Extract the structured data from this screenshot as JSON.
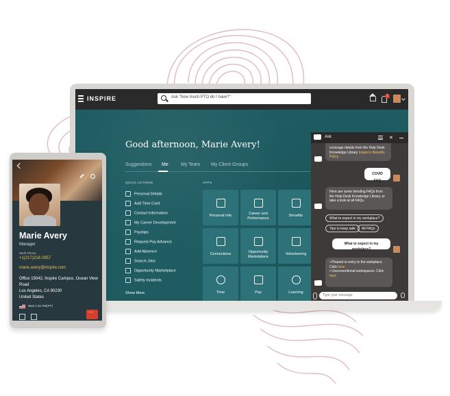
{
  "app": {
    "brand": "INSPIRE",
    "search_placeholder": "Ask \"how much PTO do I have?\"",
    "notification_count": "1"
  },
  "greeting": "Good afternoon, Marie Avery!",
  "tabs": [
    "Suggestions",
    "Me",
    "My Team",
    "My Client Groups"
  ],
  "active_tab": "Me",
  "quick_actions": {
    "heading": "QUICK ACTIONS",
    "items": [
      "Personal Details",
      "Add Time Card",
      "Contact Information",
      "My Career Development",
      "Payslips",
      "Request Pay Advance",
      "Add Absence",
      "Search Jobs",
      "Opportunity Marketplace",
      "Safety Incidents"
    ],
    "show_more": "Show More"
  },
  "apps": {
    "heading": "APPS",
    "tiles": [
      "Personal Info",
      "Career and Performance",
      "Benefits",
      "Connections",
      "Opportunity Marketplace",
      "Volunteering",
      "Time",
      "Pay",
      "Learning"
    ]
  },
  "chat": {
    "title": "Ask",
    "bot_msg_1": "coverage details from the Help Desk Knowledge Library",
    "bot_msg_1_link": "Inspire's Benefits Policy",
    "user_msg_1": "COVID FAQ",
    "bot_msg_2": "Here are some trending FAQs from the Help Desk Knowledge Library, or take a look at all FAQs.",
    "chips": [
      "What to expect in my workplace?",
      "Tips to keep safe",
      "All FAQs"
    ],
    "user_msg_2": "What to expect in my workplace?",
    "bullet_1": "Phased re-entry to the workplace. Click",
    "bullet_2": "Unconventional workspaces. Click",
    "link_word": "here",
    "input_placeholder": "Type your message"
  },
  "profile": {
    "name": "Marie Avery",
    "title": "Manager",
    "phone_label": "Work Phone",
    "phone": "+1(217)218-2957",
    "email": "marie.avery@inspire.com",
    "address": "Office 15042, Inspire Campus, Ocean View Road\nLos Angeles, CA 90230\nUnited States",
    "local_time": "Wed 1:31 PM(PT)"
  },
  "colors": {
    "teal": "#1e5c61",
    "tile": "#2c7278",
    "chat_bg": "#3d3b3a",
    "accent_link": "#e8c35b",
    "alert": "#d83f2a"
  }
}
